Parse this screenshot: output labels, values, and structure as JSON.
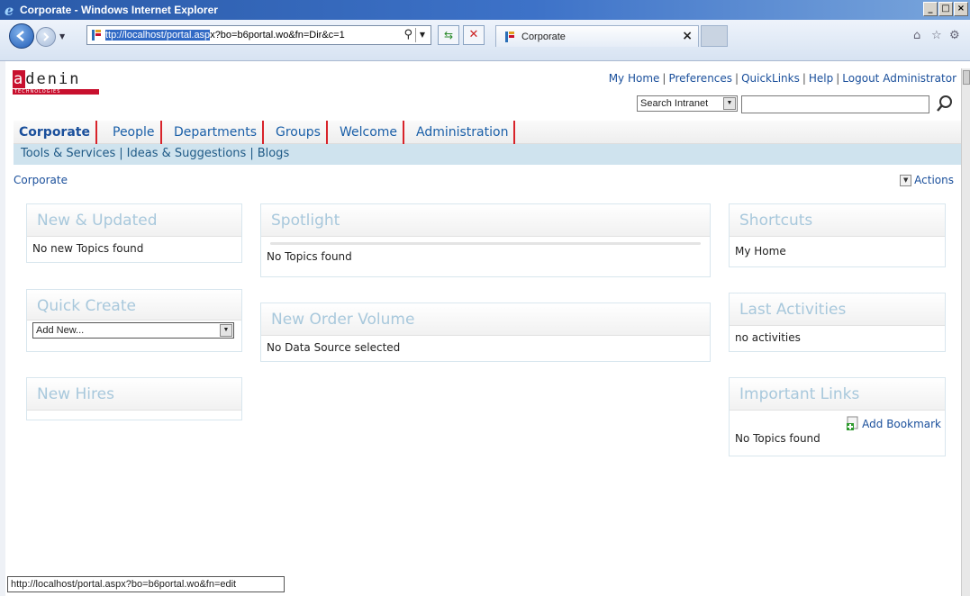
{
  "window": {
    "title": "Corporate - Windows Internet Explorer"
  },
  "browser": {
    "url_selected": "ttp://localhost/portal.asp",
    "url_rest": "x?bo=b6portal.wo&fn=Dir&c=1",
    "tab_title": "Corporate",
    "status_text": "http://localhost/portal.aspx?bo=b6portal.wo&fn=edit"
  },
  "logo": {
    "brand_a": "a",
    "brand_rest": "denin",
    "tagline": "TECHNOLOGIES"
  },
  "top_links": {
    "my_home": "My Home",
    "preferences": "Preferences",
    "quicklinks": "QuickLinks",
    "help": "Help",
    "logout": "Logout Administrator",
    "sep": "|"
  },
  "search": {
    "scope": "Search Intranet",
    "query": ""
  },
  "nav_main": [
    {
      "label": "Corporate",
      "active": true
    },
    {
      "label": "People"
    },
    {
      "label": "Departments"
    },
    {
      "label": "Groups"
    },
    {
      "label": "Welcome"
    },
    {
      "label": "Administration"
    }
  ],
  "nav_sub": [
    "Tools & Services",
    "Ideas & Suggestions",
    "Blogs"
  ],
  "nav_sub_sep": "|",
  "breadcrumb": "Corporate",
  "actions_label": "Actions",
  "portlets": {
    "new_updated": {
      "title": "New & Updated",
      "body": "No new Topics found"
    },
    "quick_create": {
      "title": "Quick Create",
      "select_value": "Add New..."
    },
    "new_hires": {
      "title": "New Hires"
    },
    "spotlight": {
      "title": "Spotlight",
      "body": "No Topics found"
    },
    "new_order_volume": {
      "title": "New Order Volume",
      "body": "No Data Source selected"
    },
    "shortcuts": {
      "title": "Shortcuts",
      "link": "My Home"
    },
    "last_activities": {
      "title": "Last Activities",
      "body": "no activities"
    },
    "important_links": {
      "title": "Important Links",
      "add_label": "Add Bookmark",
      "body": "No Topics found"
    }
  },
  "colors": {
    "accent_red": "#d8232a",
    "link_blue": "#1a4f9b",
    "portlet_title": "#a8c8dc",
    "subnav_bg": "#cfe3ee"
  }
}
